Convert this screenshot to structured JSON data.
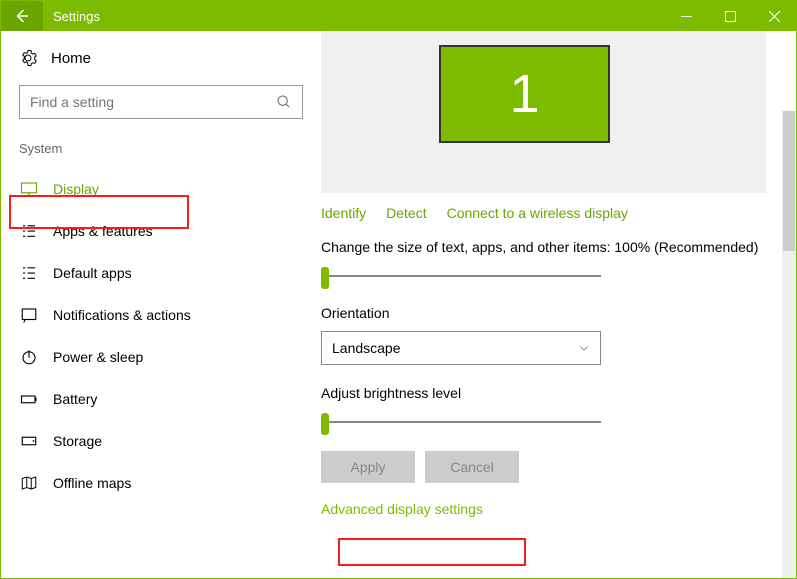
{
  "titlebar": {
    "title": "Settings"
  },
  "sidebar": {
    "home": "Home",
    "search_placeholder": "Find a setting",
    "category": "System",
    "items": [
      {
        "label": "Display",
        "active": true
      },
      {
        "label": "Apps & features"
      },
      {
        "label": "Default apps"
      },
      {
        "label": "Notifications & actions"
      },
      {
        "label": "Power & sleep"
      },
      {
        "label": "Battery"
      },
      {
        "label": "Storage"
      },
      {
        "label": "Offline maps"
      }
    ]
  },
  "display": {
    "monitor_label": "1",
    "links": [
      "Identify",
      "Detect",
      "Connect to a wireless display"
    ],
    "scale_label": "Change the size of text, apps, and other items: 100% (Recommended)",
    "orientation_label": "Orientation",
    "orientation_value": "Landscape",
    "brightness_label": "Adjust brightness level",
    "buttons": {
      "apply": "Apply",
      "cancel": "Cancel"
    },
    "advanced_link": "Advanced display settings"
  },
  "colors": {
    "accent": "#7dbb00",
    "accent_dark": "#6aa600",
    "highlight": "#ff1a1a"
  }
}
